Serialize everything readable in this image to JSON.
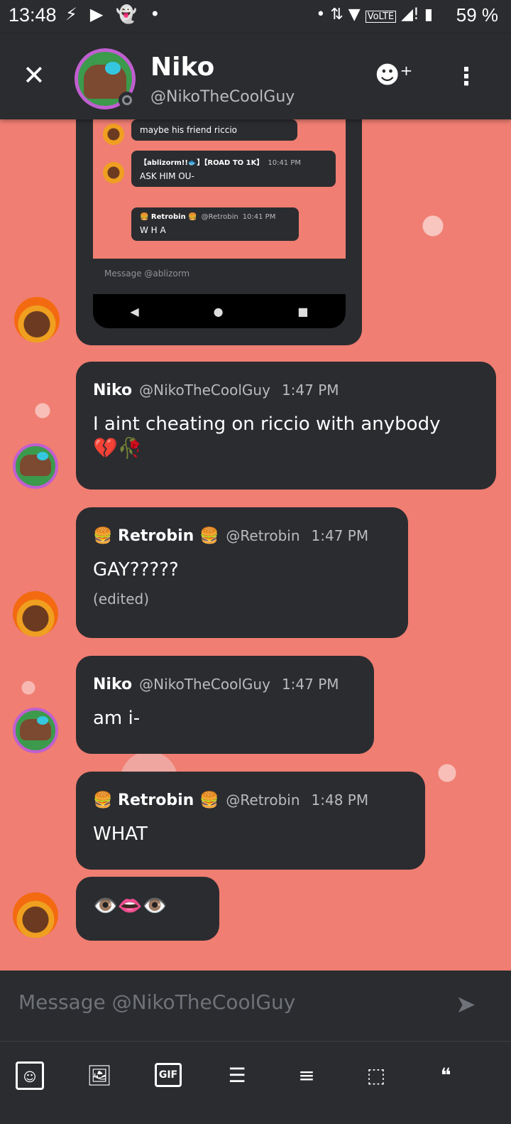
{
  "status_bar": {
    "time": "13:48",
    "left_icons": [
      "lightning-icon",
      "play-icon",
      "snapchat-icon",
      "dot-icon"
    ],
    "network": "VoLTE",
    "battery": "59 %"
  },
  "header": {
    "name": "Niko",
    "handle": "@NikoTheCoolGuy",
    "close_glyph": "✕",
    "add_friend_glyph": "☻⁺",
    "more_glyph": "⋮"
  },
  "embedded_screenshot": {
    "messages": [
      {
        "text": "maybe his friend riccio"
      },
      {
        "user": "【ablizorm!!🐟】【ROAD TO 1K】",
        "time": "10:41 PM",
        "text": "ASK HIM OU-"
      },
      {
        "user": "🍔 Retrobin 🍔",
        "handle": "@Retrobin",
        "time": "10:41 PM",
        "text": "W H A"
      }
    ],
    "input_placeholder": "Message @ablizorm",
    "nav": [
      "◀",
      "●",
      "■"
    ]
  },
  "messages": [
    {
      "user": "Niko",
      "handle": "@NikoTheCoolGuy",
      "time": "1:47 PM",
      "text": "I aint cheating on riccio with anybody",
      "emoji": "💔🥀"
    },
    {
      "user": "🍔 Retrobin 🍔",
      "handle": "@Retrobin",
      "time": "1:47 PM",
      "text": "GAY?????",
      "edited": "(edited)"
    },
    {
      "user": "Niko",
      "handle": "@NikoTheCoolGuy",
      "time": "1:47 PM",
      "text": "am i-"
    },
    {
      "user": "🍔 Retrobin 🍔",
      "handle": "@Retrobin",
      "time": "1:48 PM",
      "text": "WHAT"
    },
    {
      "text": "👁️👄👁️"
    }
  ],
  "input": {
    "placeholder": "Message @NikoTheCoolGuy",
    "send_glyph": "➤"
  },
  "toolbar": {
    "emoji_glyph": "☺",
    "image_glyph": "🖼",
    "gif_label": "GIF",
    "bullet_glyph": "☰",
    "numbered_glyph": "≡",
    "spoiler_glyph": "⬚",
    "quote_glyph": "❝"
  }
}
